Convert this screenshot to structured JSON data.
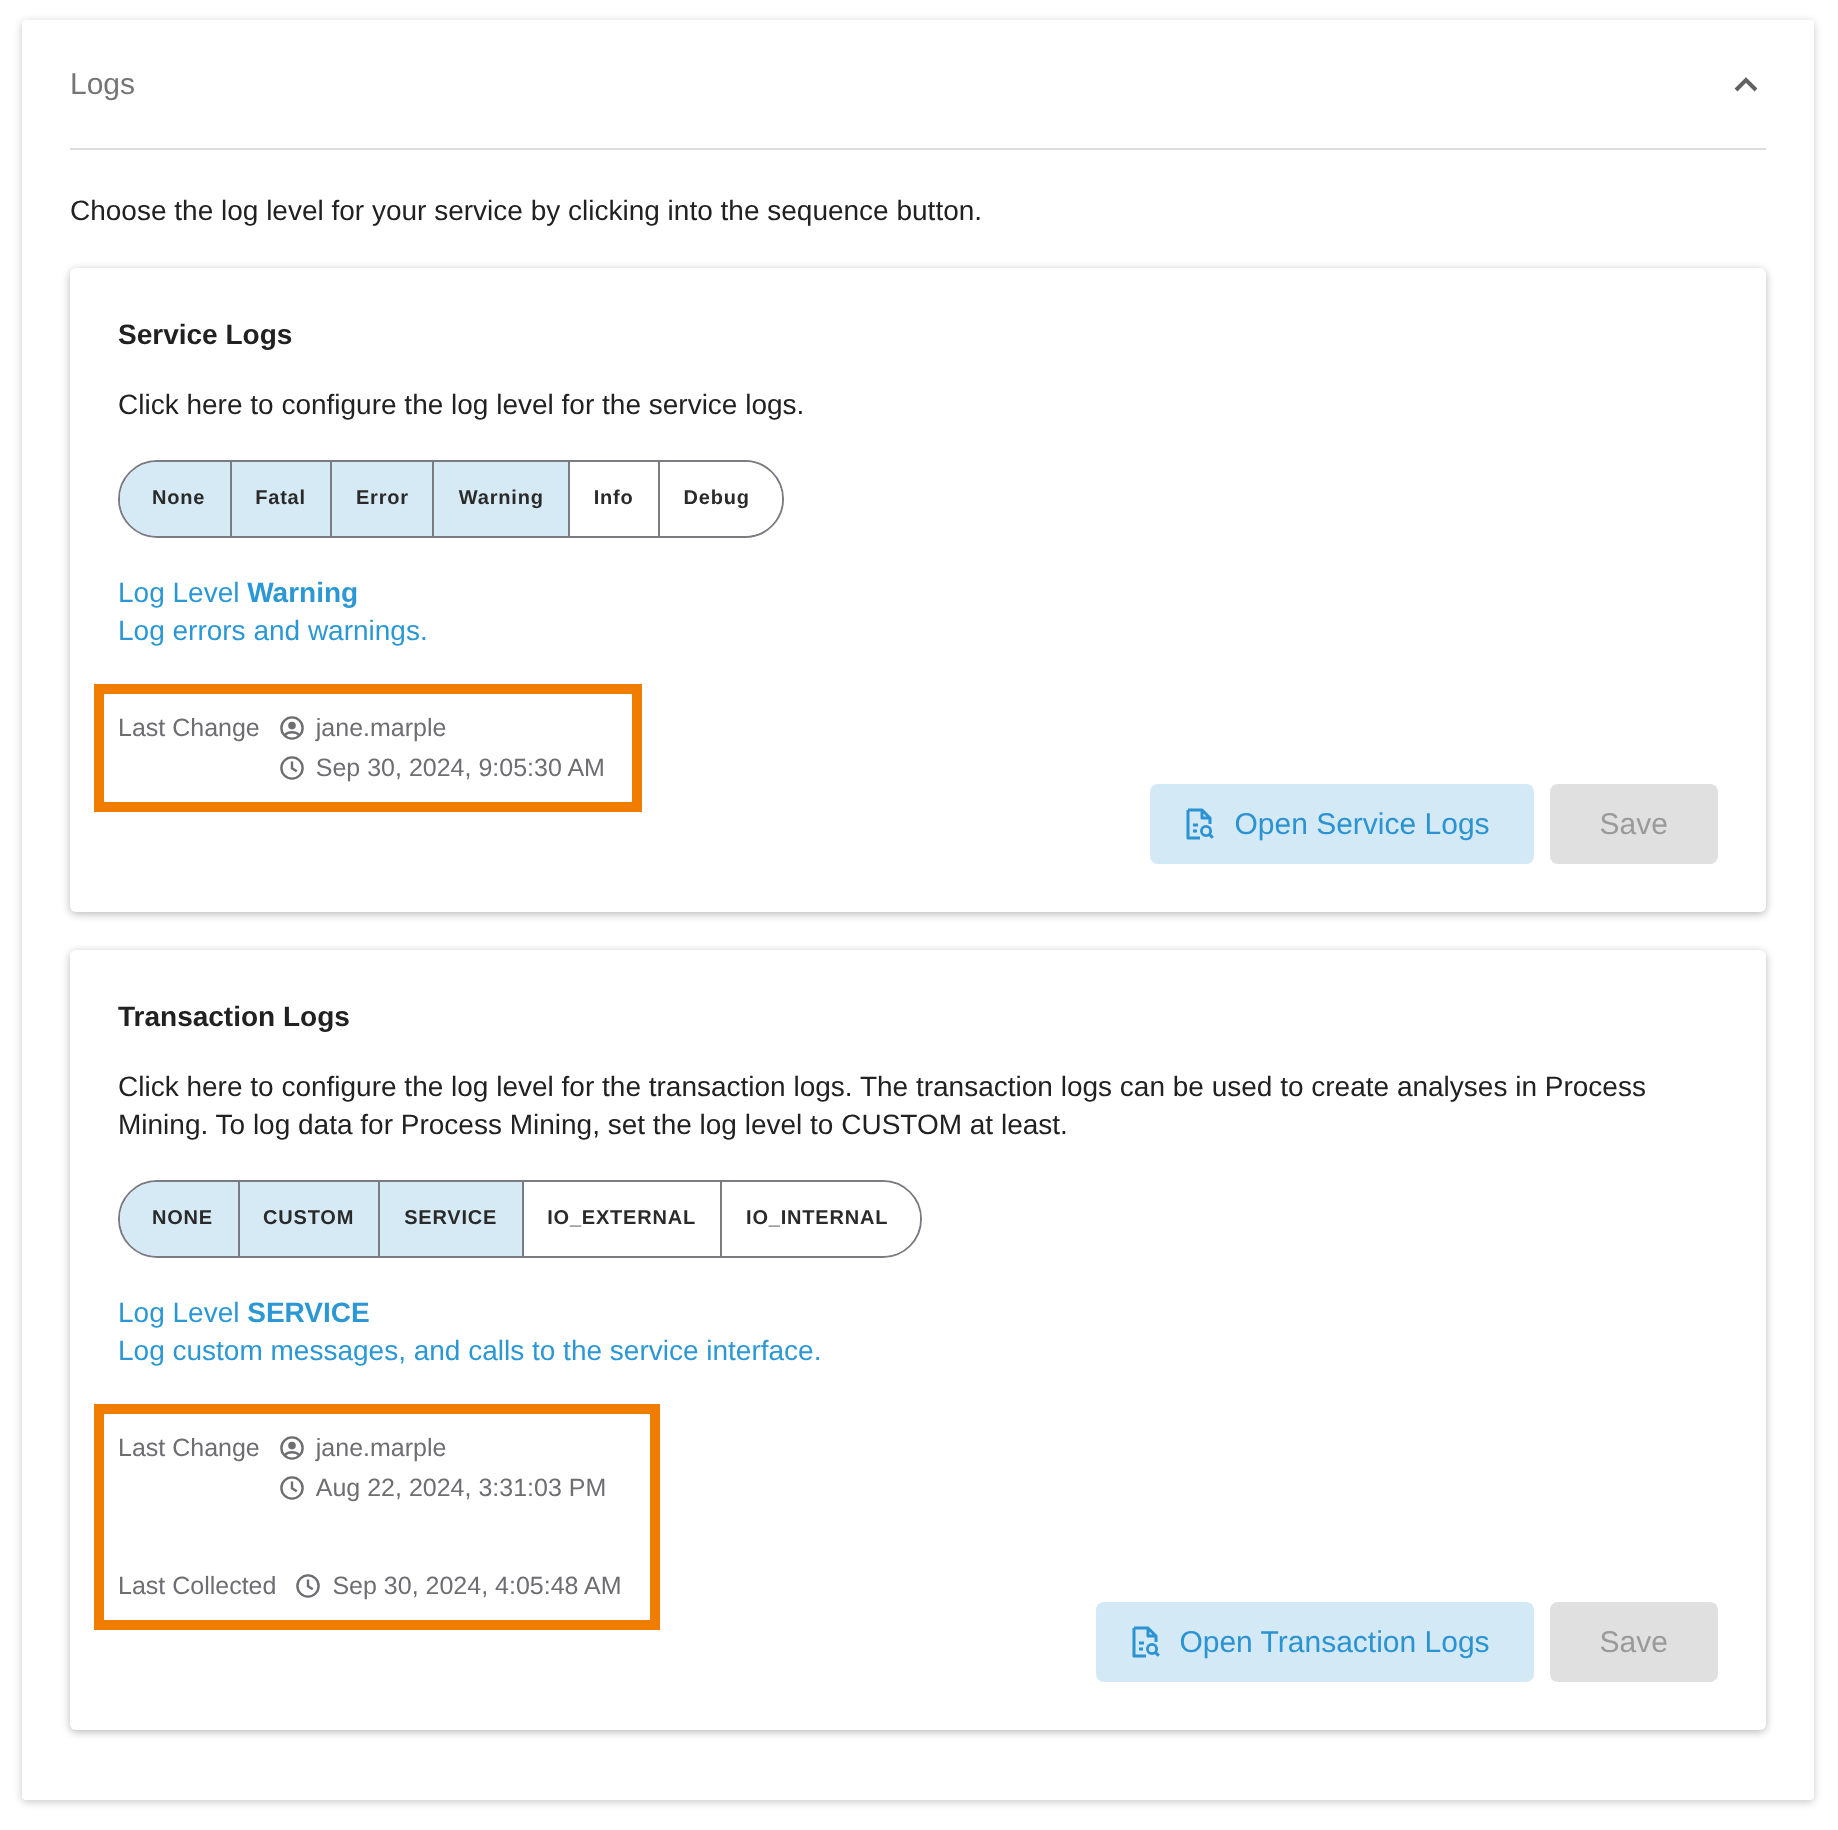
{
  "panel": {
    "title": "Logs",
    "expanded": true,
    "intro": "Choose the log level for your service by clicking into the sequence button."
  },
  "sections": [
    {
      "title": "Service Logs",
      "description": "Click here to configure the log level for the service logs.",
      "levels": [
        {
          "label": "None",
          "active": true
        },
        {
          "label": "Fatal",
          "active": true
        },
        {
          "label": "Error",
          "active": true
        },
        {
          "label": "Warning",
          "active": true
        },
        {
          "label": "Info",
          "active": false
        },
        {
          "label": "Debug",
          "active": false
        }
      ],
      "level_label": "Log Level **Warning**",
      "level_description": "Log errors and warnings.",
      "details": {
        "highlighted": true,
        "rows": [
          {
            "label": "Last Change",
            "entries": [
              {
                "kind": "user",
                "text": "jane.marple"
              },
              {
                "kind": "time",
                "text": "Sep 30, 2024, 9:05:30 AM"
              }
            ]
          }
        ]
      },
      "buttons": [
        {
          "kind": "open",
          "label": "Open Service Logs",
          "disabled": false
        },
        {
          "kind": "save",
          "label": "Save",
          "disabled": true
        }
      ]
    },
    {
      "title": "Transaction Logs",
      "description": "Click here to configure the log level for the transaction logs. The transaction logs can be used to create analyses in Process Mining. To log data for Process Mining, set the log level to CUSTOM at least.",
      "levels": [
        {
          "label": "NONE",
          "active": true
        },
        {
          "label": "CUSTOM",
          "active": true
        },
        {
          "label": "SERVICE",
          "active": true
        },
        {
          "label": "IO_EXTERNAL",
          "active": false
        },
        {
          "label": "IO_INTERNAL",
          "active": false
        }
      ],
      "level_label": "Log Level **SERVICE**",
      "level_description": "Log custom messages, and calls to the service interface.",
      "details": {
        "highlighted": true,
        "rows": [
          {
            "label": "Last Change",
            "entries": [
              {
                "kind": "user",
                "text": "jane.marple"
              },
              {
                "kind": "time",
                "text": "Aug 22, 2024, 3:31:03 PM"
              }
            ]
          },
          {
            "label": "Last Collected",
            "entries": [
              {
                "kind": "time",
                "text": "Sep 30, 2024, 4:05:48 AM"
              }
            ]
          }
        ]
      },
      "buttons": [
        {
          "kind": "open",
          "label": "Open Transaction Logs",
          "disabled": false
        },
        {
          "kind": "save",
          "label": "Save",
          "disabled": true
        }
      ]
    }
  ]
}
